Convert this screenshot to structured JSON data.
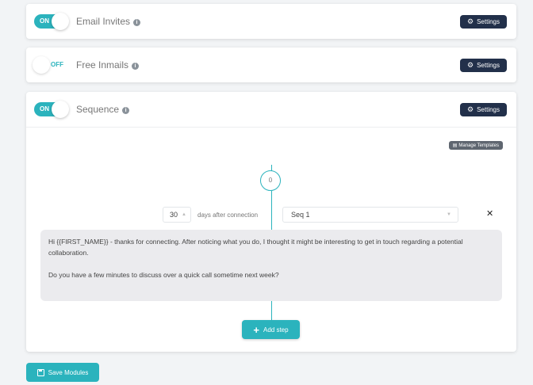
{
  "modules": [
    {
      "title": "Email Invites",
      "state": "ON",
      "settings_label": "Settings"
    },
    {
      "title": "Free Inmails",
      "state": "OFF",
      "settings_label": "Settings"
    },
    {
      "title": "Sequence",
      "state": "ON",
      "settings_label": "Settings"
    }
  ],
  "info_glyph": "i",
  "sequence": {
    "manage_templates_label": "Manage Templates",
    "step": {
      "day_marker": "0",
      "days_value": "30",
      "days_label": "days after connection",
      "selected_sequence": "Seq 1",
      "message_lines": [
        "Hi {{FIRST_NAME}} - thanks for connecting. After noticing what you do, I thought it might be interesting to get in touch regarding a potential collaboration.",
        "Do you have a few minutes to discuss over a quick call sometime next week?"
      ]
    },
    "add_step_label": "Add step"
  },
  "save_label": "Save Modules",
  "colors": {
    "accent": "#2bb3bd",
    "dark_button": "#22304a"
  }
}
